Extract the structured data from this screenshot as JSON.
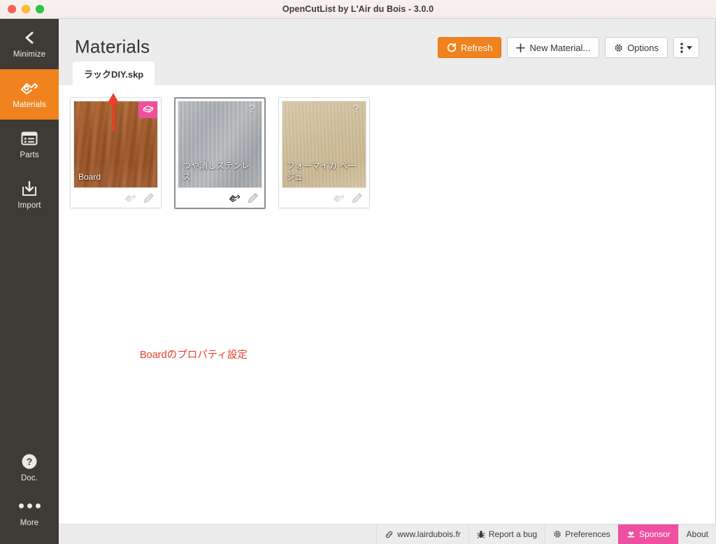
{
  "window": {
    "title": "OpenCutList by L'Air du Bois - 3.0.0",
    "controls": {
      "close": "close",
      "minimize": "minimize",
      "zoom": "zoom"
    }
  },
  "rail": {
    "items": [
      {
        "label": "Minimize",
        "icon": "chevron-left-icon",
        "active": false
      },
      {
        "label": "Materials",
        "icon": "materials-icon",
        "active": true
      },
      {
        "label": "Parts",
        "icon": "parts-list-icon",
        "active": false
      },
      {
        "label": "Import",
        "icon": "import-icon",
        "active": false
      }
    ],
    "bottom": [
      {
        "label": "Doc.",
        "icon": "question-circle-icon"
      },
      {
        "label": "More",
        "icon": "ellipsis-icon"
      }
    ]
  },
  "header": {
    "title": "Materials",
    "toolbar": {
      "refresh_label": "Refresh",
      "new_material_label": "New Material...",
      "options_label": "Options",
      "more_label": ""
    }
  },
  "tabs": [
    {
      "label": "ラックDIY.skp",
      "active": true
    }
  ],
  "materials": [
    {
      "name": "Board",
      "texture": "wood",
      "badge": "board-type-icon",
      "badge_kind": "typed",
      "selected": false,
      "actions": [
        "material-link-icon",
        "edit-pencil-icon"
      ],
      "link_active": false
    },
    {
      "name": "つや消しステンレス",
      "texture": "steel",
      "badge": "?",
      "badge_kind": "unknown",
      "selected": true,
      "actions": [
        "material-link-icon",
        "edit-pencil-icon"
      ],
      "link_active": true
    },
    {
      "name": "フォーマイカ ベージュ",
      "texture": "formica",
      "badge": "?",
      "badge_kind": "unknown",
      "selected": false,
      "actions": [
        "material-link-icon",
        "edit-pencil-icon"
      ],
      "link_active": false
    }
  ],
  "annotation": {
    "text": "Boardのプロパティ設定",
    "color": "#e8402a",
    "arrow": "up-arrow"
  },
  "footer": {
    "items": [
      {
        "label": "www.lairdubois.fr",
        "icon": "link-icon",
        "style": "default"
      },
      {
        "label": "Report a bug",
        "icon": "bug-icon",
        "style": "default"
      },
      {
        "label": "Preferences",
        "icon": "gear-icon",
        "style": "default"
      },
      {
        "label": "Sponsor",
        "icon": "heart-hand-icon",
        "style": "sponsor"
      },
      {
        "label": "About",
        "icon": "",
        "style": "default"
      }
    ]
  },
  "colors": {
    "accent_orange": "#f0831e",
    "sponsor_pink": "#ef4fa0",
    "badge_pink": "#f0509b",
    "rail_dark": "#3e3b36",
    "annotation_red": "#e8402a"
  }
}
